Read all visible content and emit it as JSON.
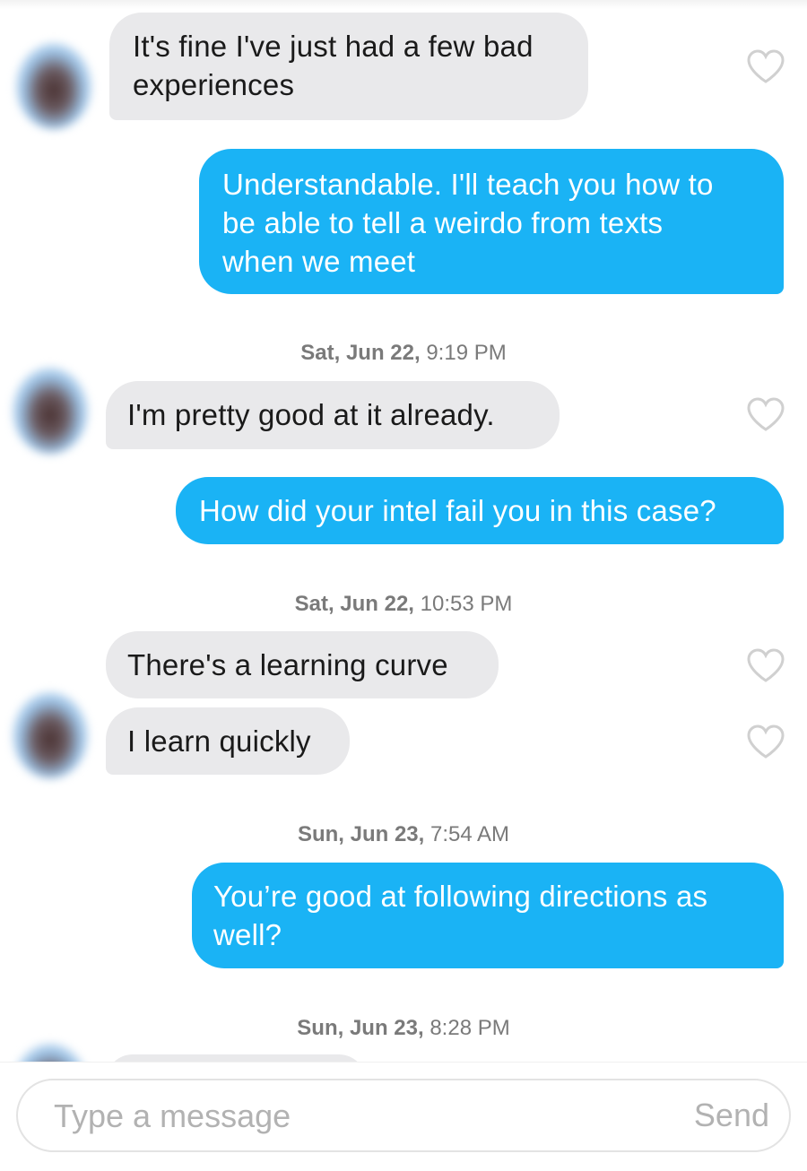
{
  "messages": [
    {
      "direction": "in",
      "lines": [
        "It's fine I've just had a few bad",
        "experiences"
      ]
    },
    {
      "direction": "out",
      "lines": [
        "Understandable. I'll teach you how to",
        "be able to tell a weirdo from texts",
        "when we meet"
      ]
    },
    {
      "direction": "in",
      "lines": [
        "I'm pretty good at it already."
      ]
    },
    {
      "direction": "out",
      "lines": [
        "How did your intel fail you in this case?"
      ]
    },
    {
      "direction": "in",
      "lines": [
        "There's a learning curve"
      ]
    },
    {
      "direction": "in",
      "lines": [
        "I learn quickly"
      ]
    },
    {
      "direction": "out",
      "lines": [
        "You’re good at following directions as",
        "well?"
      ]
    }
  ],
  "timestamps": [
    {
      "date": "Sat, Jun 22,",
      "time": "9:19 PM"
    },
    {
      "date": "Sat, Jun 22,",
      "time": "10:53 PM"
    },
    {
      "date": "Sun, Jun 23,",
      "time": "7:54 AM"
    },
    {
      "date": "Sun, Jun 23,",
      "time": "8:28 PM"
    }
  ],
  "composer": {
    "placeholder": "Type a message",
    "send_label": "Send"
  },
  "colors": {
    "outgoing_bubble": "#1ab3f5",
    "incoming_bubble": "#e9e9eb",
    "timestamp_text": "#7a7a7a",
    "heart_outline": "#d0d0d0"
  },
  "icons": [
    "like-heart-icon",
    "avatar"
  ]
}
